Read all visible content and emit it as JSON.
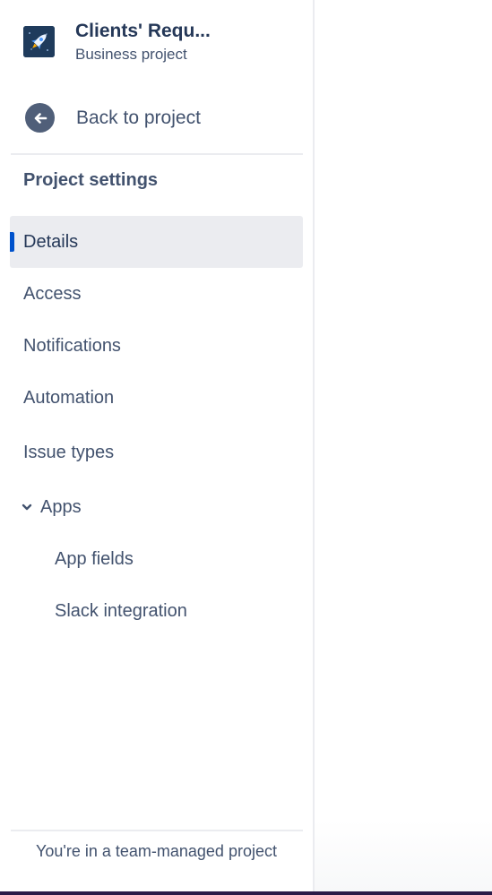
{
  "project": {
    "name": "Clients' Requ...",
    "type": "Business project",
    "avatar_icon": "rocket-icon"
  },
  "back_link": {
    "label": "Back to project",
    "icon": "arrow-left-icon"
  },
  "section_heading": "Project settings",
  "nav": {
    "details": "Details",
    "access": "Access",
    "notifications": "Notifications",
    "automation": "Automation",
    "issue_types": "Issue types",
    "apps": "Apps",
    "app_fields": "App fields",
    "slack_integration": "Slack integration"
  },
  "selected_item": "Details",
  "footer": {
    "text": "You're in a team-managed project"
  },
  "colors": {
    "accent": "#0052cc",
    "selected_bg": "#ebecf0",
    "text": "#42526e",
    "avatar_bg": "#1f3b5c"
  }
}
